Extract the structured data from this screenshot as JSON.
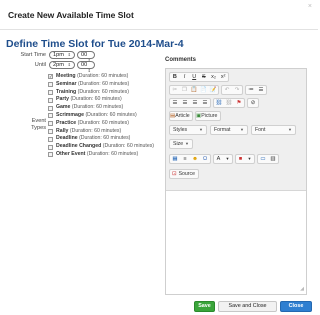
{
  "dialog": {
    "title": "Create New Available Time Slot",
    "close_glyph": "×",
    "heading": "Define Time Slot for Tue 2014-Mar-4"
  },
  "form": {
    "start_label": "Start Time",
    "start_hour": "1pm",
    "start_minute": "00",
    "until_label": "Until",
    "until_hour": "2pm",
    "until_minute": "00",
    "event_types_label_1": "Event",
    "event_types_label_2": "Types",
    "event_types": [
      {
        "name": "Meeting",
        "duration": "(Duration: 60 minutes)",
        "checked": true
      },
      {
        "name": "Seminar",
        "duration": "(Duration: 60 minutes)",
        "checked": false
      },
      {
        "name": "Training",
        "duration": "(Duration: 60 minutes)",
        "checked": false
      },
      {
        "name": "Party",
        "duration": "(Duration: 60 minutes)",
        "checked": false
      },
      {
        "name": "Game",
        "duration": "(Duration: 60 minutes)",
        "checked": false
      },
      {
        "name": "Scrimmage",
        "duration": "(Duration: 60 minutes)",
        "checked": false
      },
      {
        "name": "Practice",
        "duration": "(Duration: 60 minutes)",
        "checked": false
      },
      {
        "name": "Rally",
        "duration": "(Duration: 60 minutes)",
        "checked": false
      },
      {
        "name": "Deadline",
        "duration": "(Duration: 60 minutes)",
        "checked": false
      },
      {
        "name": "Deadline Changed",
        "duration": "(Duration: 60 minutes)",
        "checked": false
      },
      {
        "name": "Other Event",
        "duration": "(Duration: 60 minutes)",
        "checked": false
      }
    ]
  },
  "comments": {
    "label": "Comments",
    "toolbar": {
      "row1": [
        "B",
        "I",
        "U",
        "S",
        "x₂",
        "x²"
      ],
      "article_label": "Article",
      "picture_label": "Picture",
      "styles_label": "Styles",
      "format_label": "Format",
      "font_label": "Font",
      "size_label": "Size",
      "source_label": "Source"
    }
  },
  "footer": {
    "save_label": "Save",
    "save_close_label": "Save and Close",
    "close_label": "Close"
  },
  "colors": {
    "heading": "#1f4e8c",
    "save": "#3aa53a",
    "close": "#2f7fd1"
  }
}
